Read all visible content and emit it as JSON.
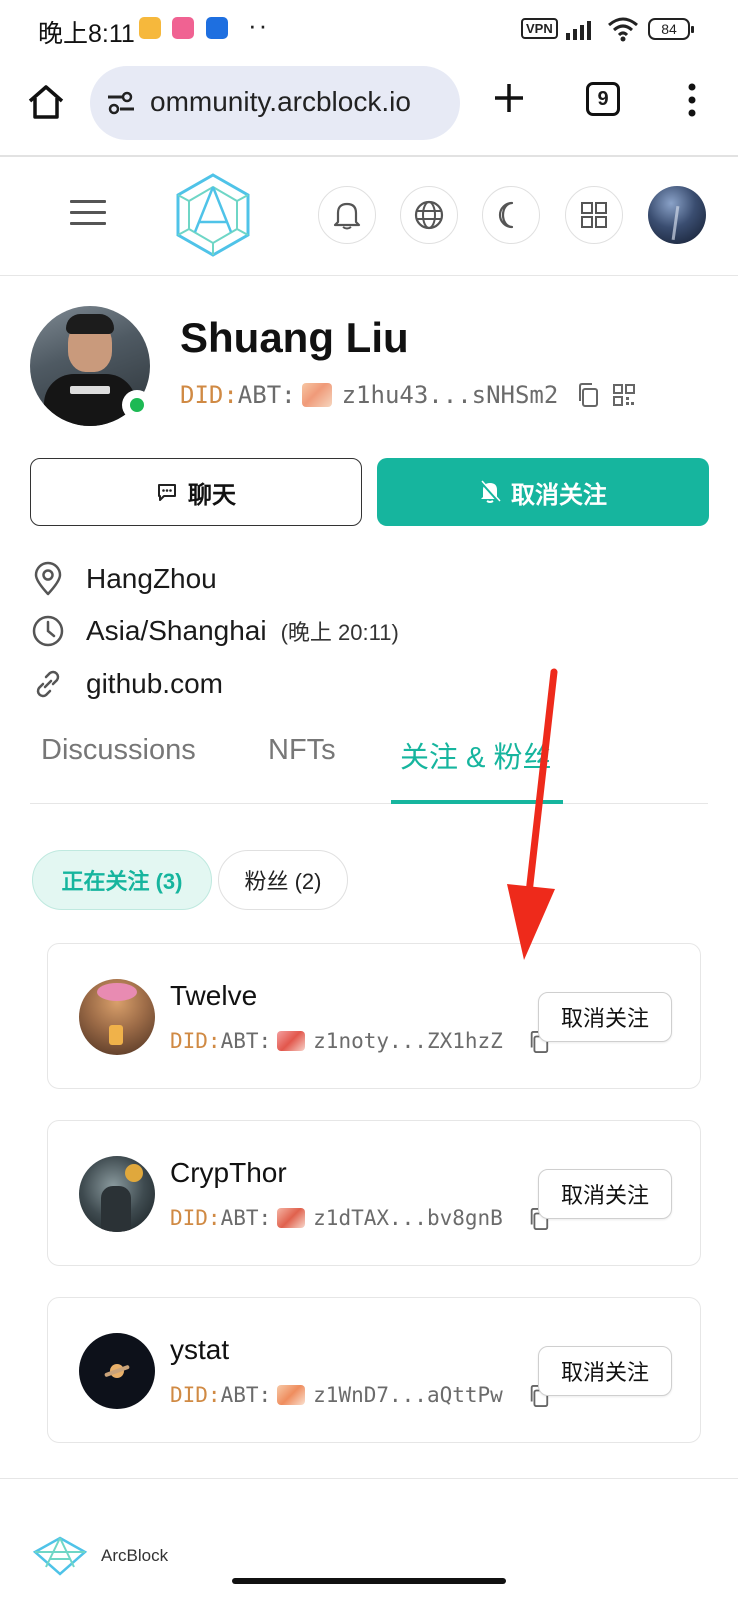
{
  "status_bar": {
    "time": "晚上8:11",
    "vpn": "VPN",
    "battery": "84"
  },
  "browser": {
    "url": "ommunity.arcblock.io",
    "tab_count": "9"
  },
  "profile": {
    "name": "Shuang Liu",
    "did_prefix": "DID:",
    "did_type": "ABT:",
    "did_short": "z1hu43...sNHSm2",
    "chat_label": "聊天",
    "unfollow_label": "取消关注",
    "location": "HangZhou",
    "timezone": "Asia/Shanghai",
    "local_time": "(晚上 20:11)",
    "website": "github.com"
  },
  "tabs": {
    "discussions": "Discussions",
    "nfts": "NFTs",
    "follow": "关注 & 粉丝",
    "active": "follow"
  },
  "subtabs": {
    "following": "正在关注 (3)",
    "followers": "粉丝 (2)"
  },
  "following": [
    {
      "name": "Twelve",
      "did_prefix": "DID:",
      "did_type": "ABT:",
      "did_short": "z1noty...ZX1hzZ",
      "action": "取消关注"
    },
    {
      "name": "CrypThor",
      "did_prefix": "DID:",
      "did_type": "ABT:",
      "did_short": "z1dTAX...bv8gnB",
      "action": "取消关注"
    },
    {
      "name": "ystat",
      "did_prefix": "DID:",
      "did_type": "ABT:",
      "did_short": "z1WnD7...aQttPw",
      "action": "取消关注"
    }
  ],
  "footer": {
    "brand": "ArcBlock"
  },
  "colors": {
    "accent": "#16b59e",
    "did_prefix": "#d08a44",
    "annotation_arrow": "#ee2a1b",
    "online": "#1db954"
  }
}
